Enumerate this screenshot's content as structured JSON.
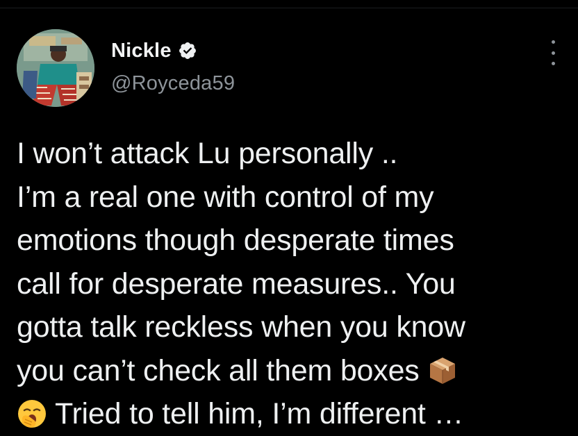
{
  "author": {
    "display_name": "Nickle",
    "handle": "@Royceda59",
    "verified": true,
    "avatar_icon": "profile-photo-icon"
  },
  "menu": {
    "icon": "more-options-icon"
  },
  "tweet": {
    "lines": [
      "I won’t attack Lu personally ..",
      "I’m a real one with control of my",
      "emotions though desperate times",
      "call for desperate measures.. You",
      "gotta talk reckless when you know",
      "you can’t check all them boxes ",
      " Tried to tell him, I’m different …"
    ],
    "emojis": [
      "package-emoji-icon",
      "yawning-face-emoji-icon"
    ]
  },
  "colors": {
    "background": "#000000",
    "text": "#e7e9ea",
    "secondary": "#8e949a"
  }
}
